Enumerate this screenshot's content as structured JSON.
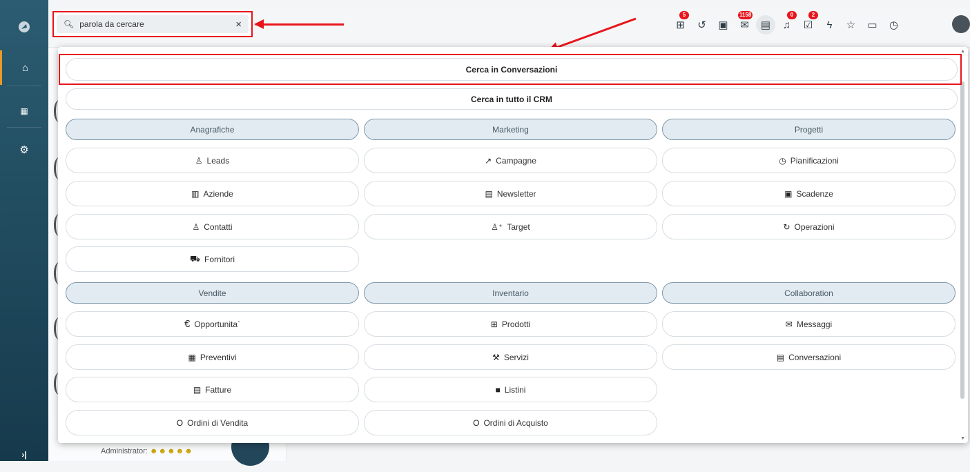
{
  "search": {
    "value": "parola da cercare",
    "clear_icon": "×"
  },
  "topbar_badges": {
    "hierarchy": "5",
    "mail": "1158",
    "bell": "0",
    "tasks": "2"
  },
  "dropdown": {
    "search_in_current": "Cerca in Conversazioni",
    "search_all": "Cerca in tutto il CRM",
    "groups": [
      {
        "heading": "Anagrafiche",
        "items": [
          "Leads",
          "Aziende",
          "Contatti",
          "Fornitori"
        ]
      },
      {
        "heading": "Marketing",
        "items": [
          "Campagne",
          "Newsletter",
          "Target"
        ]
      },
      {
        "heading": "Progetti",
        "items": [
          "Pianificazioni",
          "Scadenze",
          "Operazioni"
        ]
      },
      {
        "heading": "Vendite",
        "items": [
          "Opportunita`",
          "Preventivi",
          "Fatture",
          "Ordini di Vendita"
        ]
      },
      {
        "heading": "Inventario",
        "items": [
          "Prodotti",
          "Servizi",
          "Listini",
          "Ordini di Acquisto"
        ]
      },
      {
        "heading": "Collaboration",
        "items": [
          "Messaggi",
          "Conversazioni"
        ]
      }
    ]
  },
  "background": {
    "footer_label": "Administrator:"
  },
  "icons": {
    "search": "search-icon",
    "close": "close-icon",
    "leads": "person-icon",
    "aziende": "building-icon",
    "contatti": "person-icon",
    "fornitori": "truck-icon",
    "campagne": "trend-icon",
    "newsletter": "newsletter-icon",
    "target": "add-person-icon",
    "pianificazioni": "clock-icon",
    "scadenze": "calendar-icon",
    "operazioni": "refresh-icon",
    "opportunita": "euro-icon",
    "preventivi": "calculator-icon",
    "fatture": "document-icon",
    "ordini_vendita": "circle-icon",
    "prodotti": "grid-icon",
    "servizi": "wrench-icon",
    "listini": "book-icon",
    "ordini_acquisto": "circle-icon",
    "messaggi": "mail-icon",
    "conversazioni": "chat-icon"
  },
  "colors": {
    "highlight": "#e8141b",
    "sidebar_top": "#2b5c71",
    "sidebar_bottom": "#163a4c",
    "sidebar_accent": "#e89a2c",
    "group_heading_bg": "#e2ebf1"
  }
}
